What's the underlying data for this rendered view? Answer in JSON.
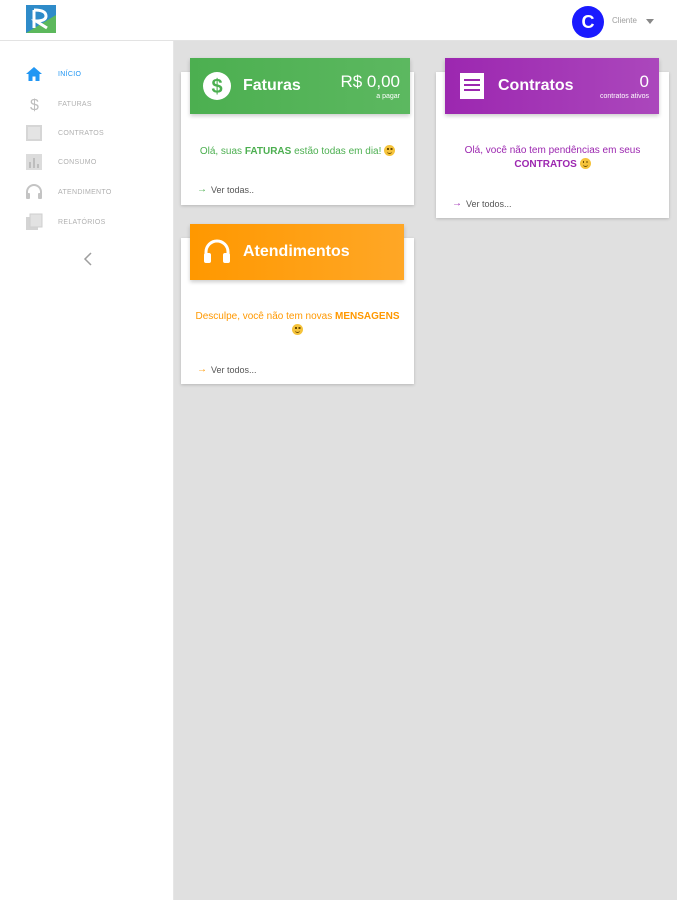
{
  "header": {
    "avatar_initial": "C",
    "user_label": "Cliente"
  },
  "sidebar": {
    "items": [
      {
        "label": "INÍCIO",
        "icon": "home-icon",
        "active": true
      },
      {
        "label": "FATURAS",
        "icon": "dollar-icon",
        "active": false
      },
      {
        "label": "CONTRATOS",
        "icon": "contracts-icon",
        "active": false
      },
      {
        "label": "CONSUMO",
        "icon": "bar-chart-icon",
        "active": false
      },
      {
        "label": "ATENDIMENTO",
        "icon": "headset-icon",
        "active": false
      },
      {
        "label": "RELATÓRIOS",
        "icon": "reports-icon",
        "active": false
      }
    ],
    "collapse_icon": "chevron-left-icon"
  },
  "cards": {
    "faturas": {
      "title": "Faturas",
      "value": "R$ 0,00",
      "value_caption": "a pagar",
      "msg_pre": "Olá, suas ",
      "msg_bold": "FATURAS",
      "msg_post": " estão todas em dia! ",
      "link": "Ver todas..",
      "color": "#4caf50"
    },
    "contratos": {
      "title": "Contratos",
      "value": "0",
      "value_caption": "contratos ativos",
      "msg_pre": "Olá, você não tem pendências em seus",
      "msg_bold": "CONTRATOS",
      "link": "Ver todos...",
      "color": "#9c27b0"
    },
    "atendimentos": {
      "title": "Atendimentos",
      "msg_pre": "Desculpe, você não tem novas ",
      "msg_bold": "MENSAGENS",
      "link": "Ver todos...",
      "color": "#ff9800"
    }
  },
  "colors": {
    "accent_blue": "#2196f3",
    "avatar_bg": "#1a1aff",
    "main_bg": "#e0e0e0"
  }
}
